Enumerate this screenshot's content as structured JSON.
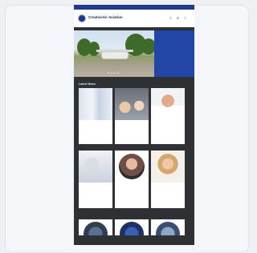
{
  "app": {
    "title": "CreativeAir Aviation"
  },
  "header": {
    "logo_text": "CreativeAir Aviation",
    "logo_subtext": "",
    "utility_text": "",
    "icons": [
      "search-icon",
      "menu-icon",
      "user-icon"
    ]
  },
  "hero": {
    "caption": "",
    "slide_count": 4
  },
  "news": {
    "section_title": "Latest News",
    "items": [
      {
        "title": "",
        "date": ""
      },
      {
        "title": "",
        "date": ""
      },
      {
        "title": "",
        "date": ""
      },
      {
        "title": "",
        "date": ""
      },
      {
        "title": "",
        "date": ""
      },
      {
        "title": "",
        "date": ""
      }
    ]
  },
  "colors": {
    "brand": "#1f3a8a",
    "hero_panel": "#1f46a6",
    "page_bg": "#2f3134"
  }
}
